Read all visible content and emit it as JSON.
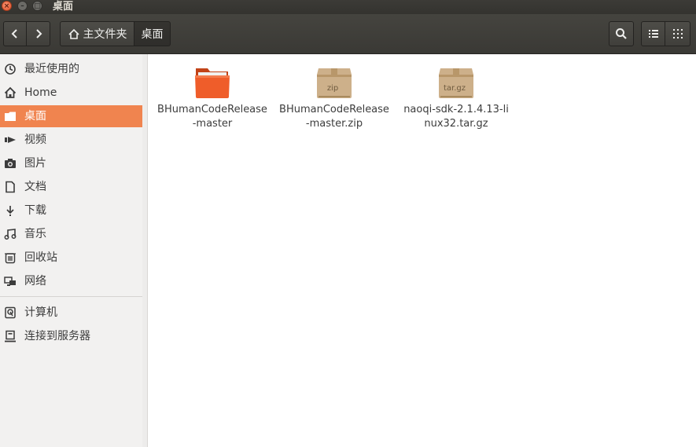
{
  "window": {
    "title": "桌面",
    "close_glyph": "×",
    "min_glyph": "–",
    "max_glyph": "□"
  },
  "toolbar": {
    "breadcrumb_home": "主文件夹",
    "breadcrumb_current": "桌面",
    "back_icon": "chevron-left-icon",
    "forward_icon": "chevron-right-icon",
    "search_icon": "search-icon",
    "list_view_icon": "list-view-icon",
    "grid_view_icon": "grid-view-icon"
  },
  "sidebar": {
    "items": [
      {
        "label": "最近使用的",
        "icon": "clock-icon",
        "active": false
      },
      {
        "label": "Home",
        "icon": "home-icon",
        "active": false
      },
      {
        "label": "桌面",
        "icon": "folder-icon",
        "active": true
      },
      {
        "label": "视频",
        "icon": "video-icon",
        "active": false
      },
      {
        "label": "图片",
        "icon": "camera-icon",
        "active": false
      },
      {
        "label": "文档",
        "icon": "document-icon",
        "active": false
      },
      {
        "label": "下载",
        "icon": "download-icon",
        "active": false
      },
      {
        "label": "音乐",
        "icon": "music-icon",
        "active": false
      },
      {
        "label": "回收站",
        "icon": "trash-icon",
        "active": false
      },
      {
        "label": "网络",
        "icon": "network-icon",
        "active": false
      },
      {
        "label": "计算机",
        "icon": "computer-icon",
        "active": false
      },
      {
        "label": "连接到服务器",
        "icon": "server-icon",
        "active": false
      }
    ]
  },
  "files": [
    {
      "name": "BHumanCodeRelease-master",
      "type": "folder",
      "icon": "folder-icon"
    },
    {
      "name": "BHumanCodeRelease-master.zip",
      "type": "archive",
      "badge": "zip",
      "icon": "archive-icon"
    },
    {
      "name": "naoqi-sdk-2.1.4.13-linux32.tar.gz",
      "type": "archive",
      "badge": "tar.gz",
      "icon": "archive-icon"
    }
  ],
  "colors": {
    "accent": "#f0844f",
    "titlebar": "#3c3b37",
    "folder": "#ee5a2a"
  }
}
